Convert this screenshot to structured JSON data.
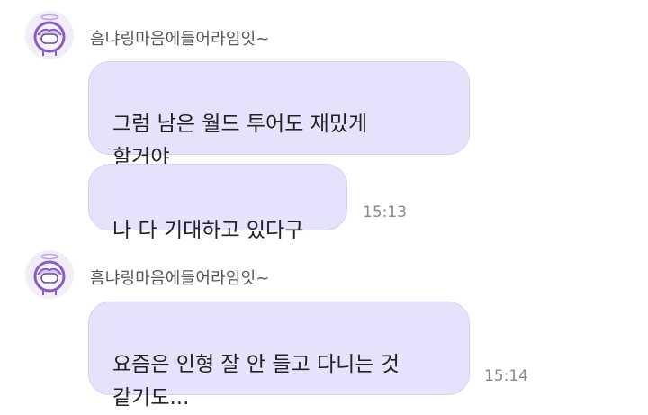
{
  "messages": [
    {
      "sender": "흠냐링마음에들어라임잇~",
      "bubbles": [
        {
          "text": "그럼 남은 월드 투어도 재밌게\n할거야",
          "time": ""
        },
        {
          "text": "나 다 기대하고 있다구",
          "time": "15:13"
        }
      ]
    },
    {
      "sender": "흠냐링마음에들어라임잇~",
      "bubbles": [
        {
          "text": "요즘은 인형 잘 안 들고 다니는 것\n같기도...",
          "time": "15:14"
        }
      ]
    }
  ],
  "colors": {
    "bubble_bg": "#e4e3fb",
    "bubble_border": "#d4d2f2",
    "avatar_accent": "#8a5ac8"
  },
  "icons": {
    "avatar": "angel-character-avatar-icon"
  }
}
